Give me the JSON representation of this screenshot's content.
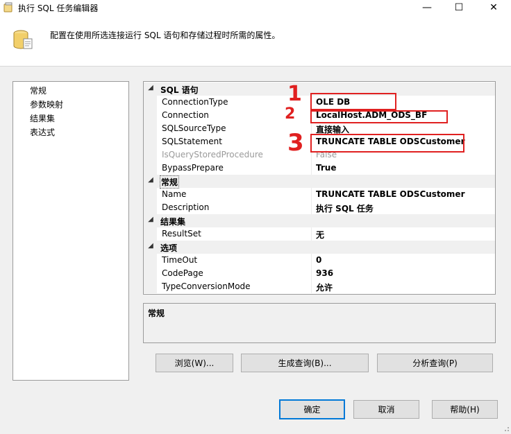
{
  "window": {
    "title": "执行 SQL 任务编辑器",
    "controls": {
      "minimize": "—",
      "maximize": "☐",
      "close": "✕"
    }
  },
  "header": {
    "description": "配置在使用所选连接运行 SQL 语句和存储过程时所需的属性。"
  },
  "nav": {
    "items": [
      {
        "label": "常规"
      },
      {
        "label": "参数映射"
      },
      {
        "label": "结果集"
      },
      {
        "label": "表达式"
      }
    ]
  },
  "grid": {
    "categories": [
      {
        "label": "SQL 语句",
        "props": [
          {
            "name": "ConnectionType",
            "value": "OLE DB"
          },
          {
            "name": "Connection",
            "value": "LocalHost.ADM_ODS_BF"
          },
          {
            "name": "SQLSourceType",
            "value": "直接输入"
          },
          {
            "name": "SQLStatement",
            "value": "TRUNCATE TABLE ODSCustomer"
          },
          {
            "name": "IsQueryStoredProcedure",
            "value": "False"
          },
          {
            "name": "BypassPrepare",
            "value": "True"
          }
        ]
      },
      {
        "label": "常规",
        "props": [
          {
            "name": "Name",
            "value": "TRUNCATE TABLE ODSCustomer"
          },
          {
            "name": "Description",
            "value": "执行 SQL 任务"
          }
        ]
      },
      {
        "label": "结果集",
        "props": [
          {
            "name": "ResultSet",
            "value": "无"
          }
        ]
      },
      {
        "label": "选项",
        "props": [
          {
            "name": "TimeOut",
            "value": "0"
          },
          {
            "name": "CodePage",
            "value": "936"
          },
          {
            "name": "TypeConversionMode",
            "value": "允许"
          }
        ]
      }
    ]
  },
  "description_box": {
    "title": "常规"
  },
  "actions": {
    "browse": "浏览(W)...",
    "build_query": "生成查询(B)...",
    "parse_query": "分析查询(P)"
  },
  "footer": {
    "ok": "确定",
    "cancel": "取消",
    "help": "帮助(H)"
  },
  "annotations": {
    "mark1": "1",
    "mark2": "2",
    "mark3": "3"
  },
  "colors": {
    "annotation": "#e02020",
    "focus": "#0078d7"
  }
}
